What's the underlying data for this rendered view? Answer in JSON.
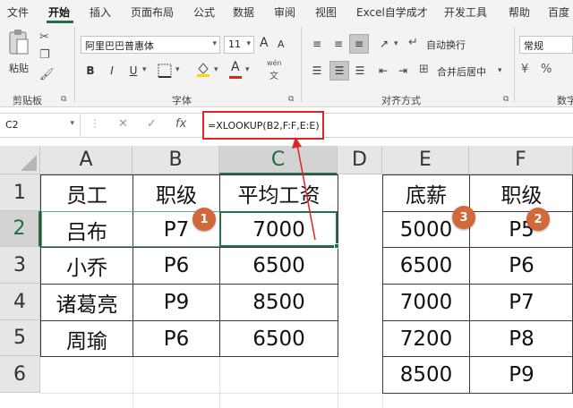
{
  "menu": {
    "items": [
      "文件",
      "开始",
      "插入",
      "页面布局",
      "公式",
      "数据",
      "审阅",
      "视图",
      "Excel自学成才",
      "开发工具",
      "帮助",
      "百度"
    ]
  },
  "ribbon": {
    "clipboard": {
      "paste_label": "粘贴",
      "group_label": "剪贴板"
    },
    "font": {
      "font_name": "阿里巴巴普惠体",
      "font_size": "11",
      "bold": "B",
      "italic": "I",
      "underline": "U",
      "grow": "A",
      "shrink": "A",
      "fill_letter": "A",
      "phonetic_top": "wén",
      "phonetic_bottom": "文",
      "group_label": "字体"
    },
    "alignment": {
      "wrap_label": "自动换行",
      "merge_label": "合并后居中",
      "group_label": "对齐方式"
    },
    "number": {
      "format": "常规",
      "group_label": "数字"
    }
  },
  "formula_bar": {
    "name_box": "C2",
    "formula": "=XLOOKUP(B2,F:F,E:E)",
    "fx": "fx"
  },
  "sheet": {
    "columns": [
      "A",
      "B",
      "C",
      "D",
      "E",
      "F"
    ],
    "rows": [
      "1",
      "2",
      "3",
      "4",
      "5",
      "6"
    ],
    "cells": {
      "A1": "员工",
      "B1": "职级",
      "C1": "平均工资",
      "A2": "吕布",
      "B2": "P7",
      "C2": "7000",
      "A3": "小乔",
      "B3": "P6",
      "C3": "6500",
      "A4": "诸葛亮",
      "B4": "P9",
      "C4": "8500",
      "A5": "周瑜",
      "B5": "P6",
      "C5": "6500",
      "E1": "底薪",
      "F1": "职级",
      "E2": "5000",
      "F2": "P5",
      "E3": "6500",
      "F3": "P6",
      "E4": "7000",
      "F4": "P7",
      "E5": "7200",
      "F5": "P8",
      "E6": "8500",
      "F6": "P9"
    }
  },
  "annotations": {
    "badge1": "1",
    "badge2": "2",
    "badge3": "3",
    "accent_color": "#d2693a",
    "highlight_color": "#e02424"
  }
}
